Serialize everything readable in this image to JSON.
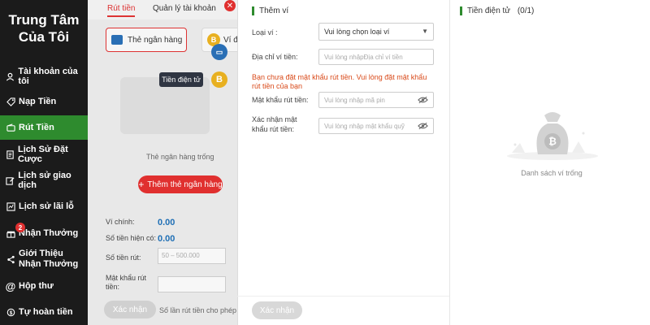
{
  "sidebar": {
    "title": "Trung Tâm Của Tôi",
    "items": [
      {
        "label": "Tài khoản của tôi",
        "icon": "user-icon"
      },
      {
        "label": "Nạp Tiền",
        "icon": "tag-icon"
      },
      {
        "label": "Rút Tiền",
        "icon": "wallet-icon"
      },
      {
        "label": "Lịch Sử Đặt Cược",
        "icon": "document-icon"
      },
      {
        "label": "Lịch sử giao dịch",
        "icon": "edit-icon"
      },
      {
        "label": "Lịch sử lãi lỗ",
        "icon": "chart-icon"
      },
      {
        "label": "Nhận Thưởng",
        "icon": "gift-icon",
        "badge": "2"
      },
      {
        "label": "Giới Thiệu Nhận Thưởng",
        "icon": "share-icon"
      },
      {
        "label": "Hộp thư",
        "icon": "at-icon"
      },
      {
        "label": "Tự hoàn tiền",
        "icon": "refund-icon"
      }
    ]
  },
  "main": {
    "tabs": [
      "Rút tiền",
      "Quản lý tài khoản"
    ],
    "bank_card_label": "Thẻ ngân hàng",
    "crypto_card_label": "Ví đ",
    "tooltip": "Tiền điện tử",
    "empty_bank": "Thẻ ngân hàng trống",
    "add_bank": "Thêm thẻ ngân hàng",
    "main_wallet_label": "Ví chính:",
    "main_wallet_value": "0.00",
    "balance_label": "Số tiền hiện có:",
    "balance_value": "0.00",
    "withdraw_amount_label": "Số tiền rút:",
    "withdraw_amount_placeholder": "50 – 500.000",
    "pin_label": "Mật khẩu rút tiền:",
    "confirm": "Xác nhận",
    "note": "Số lần rút tiền cho phép khả"
  },
  "panel": {
    "add_wallet_title": "Thêm ví",
    "wallet_type_label": "Loại ví :",
    "wallet_type_value": "Vui lòng chọn loại ví",
    "wallet_address_label": "Địa chỉ ví tiền:",
    "wallet_address_placeholder": "Vui lòng nhậpĐịa chỉ ví tiền",
    "warning": "Bạn chưa đặt mật khẩu rút tiền. Vui lòng đặt mật khẩu rút tiền của bạn",
    "pin_label": "Mật khẩu rút tiền:",
    "pin_placeholder": "Vui lòng nhập mã pin",
    "confirm_pin_label": "Xác nhận mật khẩu rút tiền:",
    "confirm_pin_placeholder": "Vui lòng nhập mật khẩu quỹ",
    "confirm_button": "Xác nhận",
    "crypto_title": "Tiền điện tử",
    "crypto_count": "(0/1)",
    "empty_list": "Danh sách ví trống"
  },
  "colors": {
    "accent_red": "#e0302f",
    "accent_green": "#2e8b2e",
    "sidebar_bg": "#1b1b1b"
  }
}
